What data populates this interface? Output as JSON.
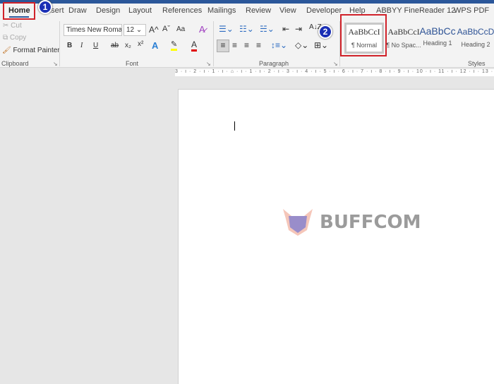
{
  "tabs": [
    "Home",
    "Insert",
    "Draw",
    "Design",
    "Layout",
    "References",
    "Mailings",
    "Review",
    "View",
    "Developer",
    "Help",
    "ABBYY FineReader 12",
    "WPS PDF"
  ],
  "active_tab": "Home",
  "clipboard": {
    "cut": "Cut",
    "copy": "Copy",
    "format_painter": "Format Painter",
    "label": "Clipboard"
  },
  "font": {
    "family": "Times New Roman",
    "size": "12",
    "label": "Font",
    "bold": "B",
    "italic": "I",
    "underline": "U",
    "strike": "ab",
    "sub": "x₂",
    "sup": "x²",
    "grow": "A^",
    "shrink": "Aˇ",
    "case": "Aa",
    "text_effects": "A",
    "font_color": "A",
    "highlight_color": "#ffff00",
    "font_color_value": "#e00000"
  },
  "paragraph": {
    "label": "Paragraph",
    "sort": "A↓Z"
  },
  "styles": {
    "label": "Styles",
    "items": [
      {
        "preview": "AaBbCcI",
        "name": "¶ Normal"
      },
      {
        "preview": "AaBbCcI",
        "name": "¶ No Spac..."
      },
      {
        "preview": "AaBbCc",
        "name": "Heading 1"
      },
      {
        "preview": "AaBbCcD",
        "name": "Heading 2"
      }
    ]
  },
  "ruler": "3 · ı · 2 · ı · 1 · ı · ⌂ · ı · 1 · ı · 2 · ı · 3 · ı · 4 · ı · 5 · ı · 6 · ı · 7 · ı · 8 · ı · 9 · ı · 10 · ı · 11 · ı · 12 · ı · 13 · ı",
  "badges": [
    "1",
    "2"
  ],
  "watermark": "BUFFCOM",
  "colors": {
    "accent": "#2b579a",
    "highlight": "#d0222a",
    "badge": "#1a2fb5"
  }
}
